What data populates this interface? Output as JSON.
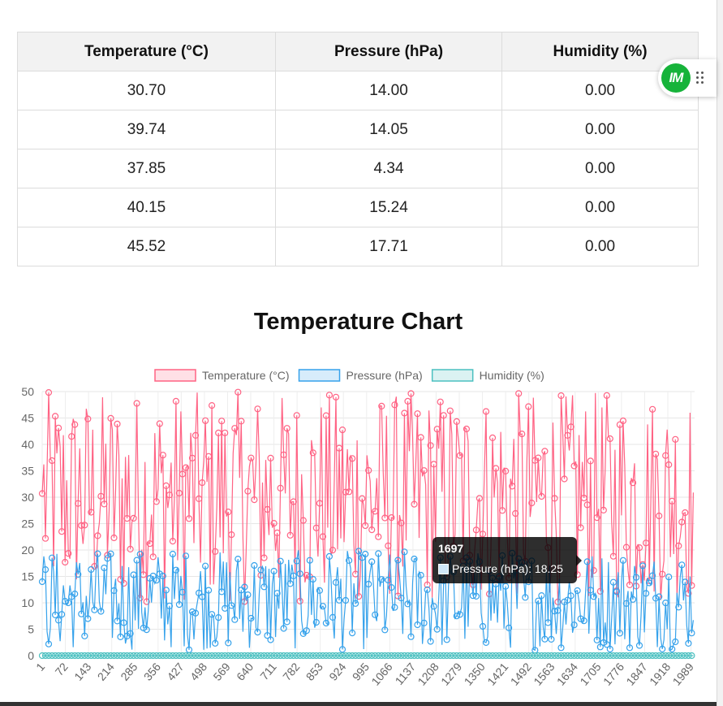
{
  "table": {
    "headers": [
      "Temperature (°C)",
      "Pressure (hPa)",
      "Humidity (%)"
    ],
    "rows": [
      [
        "30.70",
        "14.00",
        "0.00"
      ],
      [
        "39.74",
        "14.05",
        "0.00"
      ],
      [
        "37.85",
        "4.34",
        "0.00"
      ],
      [
        "40.15",
        "15.24",
        "0.00"
      ],
      [
        "45.52",
        "17.71",
        "0.00"
      ]
    ]
  },
  "widget": {
    "logo_text": "IM",
    "icon": "drag-grip-icon"
  },
  "tooltip": {
    "title": "1697",
    "label": "Pressure (hPa): 18.25"
  },
  "colors": {
    "temperature": "#ff6384",
    "pressure": "#36a2eb",
    "humidity": "#4bc0c0",
    "tooltip_bg": "#000000",
    "widget_logo": "#16b33a"
  },
  "chart_data": {
    "type": "line",
    "title": "Temperature Chart",
    "legend_position": "top",
    "grid": true,
    "ylim": [
      0,
      50
    ],
    "y_ticks": [
      0,
      5,
      10,
      15,
      20,
      25,
      30,
      35,
      40,
      45,
      50
    ],
    "x_tick_labels": [
      "1",
      "72",
      "143",
      "214",
      "285",
      "356",
      "427",
      "498",
      "569",
      "640",
      "711",
      "782",
      "853",
      "924",
      "995",
      "1066",
      "1137",
      "1208",
      "1279",
      "1350",
      "1421",
      "1492",
      "1563",
      "1634",
      "1705",
      "1776",
      "1847",
      "1918",
      "1989"
    ],
    "x_count": 2000,
    "series": [
      {
        "name": "Temperature (°C)",
        "color": "#ff6384",
        "range": [
          10,
          50
        ],
        "samples": [
          {
            "x": 1,
            "y": 30.7
          },
          {
            "x": 2,
            "y": 39.74
          },
          {
            "x": 3,
            "y": 37.85
          },
          {
            "x": 4,
            "y": 40.15
          },
          {
            "x": 5,
            "y": 45.52
          }
        ]
      },
      {
        "name": "Pressure (hPa)",
        "color": "#36a2eb",
        "range": [
          1,
          20
        ],
        "samples": [
          {
            "x": 1,
            "y": 14.0
          },
          {
            "x": 2,
            "y": 14.05
          },
          {
            "x": 3,
            "y": 4.34
          },
          {
            "x": 4,
            "y": 15.24
          },
          {
            "x": 5,
            "y": 17.71
          },
          {
            "x": 1697,
            "y": 18.25
          }
        ]
      },
      {
        "name": "Humidity (%)",
        "color": "#4bc0c0",
        "range": [
          0,
          0
        ],
        "samples": [
          {
            "x": 1,
            "y": 0
          },
          {
            "x": 2,
            "y": 0
          },
          {
            "x": 3,
            "y": 0
          },
          {
            "x": 4,
            "y": 0
          },
          {
            "x": 5,
            "y": 0
          }
        ]
      }
    ]
  }
}
